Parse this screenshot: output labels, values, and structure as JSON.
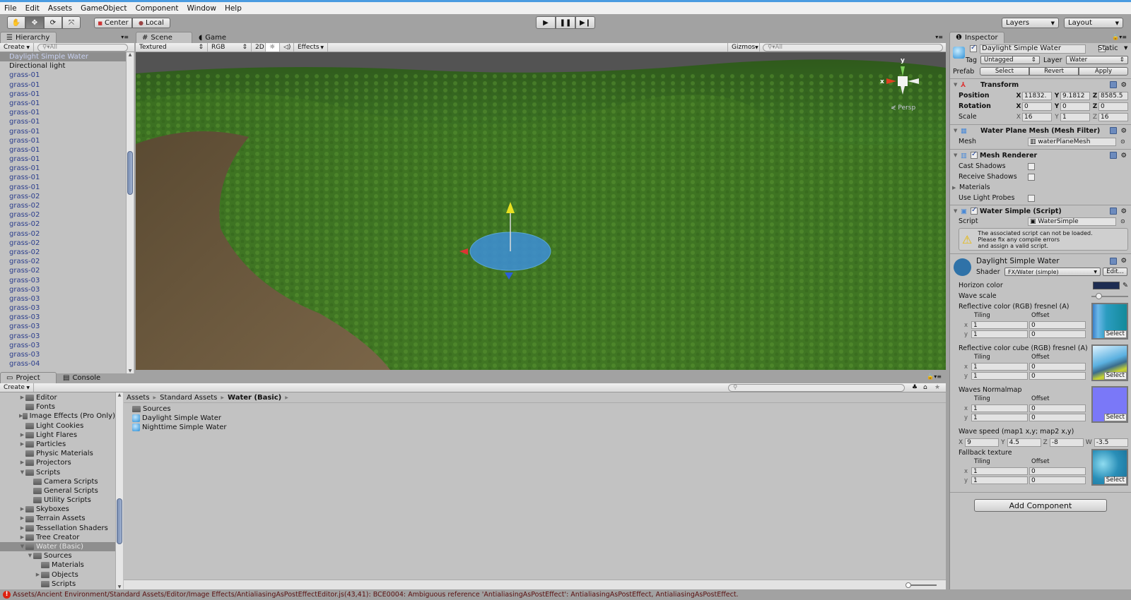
{
  "menu": [
    "File",
    "Edit",
    "Assets",
    "GameObject",
    "Component",
    "Window",
    "Help"
  ],
  "toolbar": {
    "tools": [
      "hand-icon",
      "move-icon",
      "rotate-icon",
      "scale-icon"
    ],
    "center": "Center",
    "local": "Local",
    "layers": "Layers",
    "layout": "Layout",
    "play": [
      "play-icon",
      "pause-icon",
      "step-icon"
    ]
  },
  "hierarchy": {
    "tab": "Hierarchy",
    "create": "Create",
    "search_placeholder": "All",
    "items": [
      "Daylight Simple Water",
      "Directional light",
      "grass-01",
      "grass-01",
      "grass-01",
      "grass-01",
      "grass-01",
      "grass-01",
      "grass-01",
      "grass-01",
      "grass-01",
      "grass-01",
      "grass-01",
      "grass-01",
      "grass-01",
      "grass-02",
      "grass-02",
      "grass-02",
      "grass-02",
      "grass-02",
      "grass-02",
      "grass-02",
      "grass-02",
      "grass-02",
      "grass-03",
      "grass-03",
      "grass-03",
      "grass-03",
      "grass-03",
      "grass-03",
      "grass-03",
      "grass-03",
      "grass-03",
      "grass-04"
    ],
    "selected": "Daylight Simple Water"
  },
  "scene": {
    "tab": "Scene",
    "game_tab": "Game",
    "shading": "Textured",
    "channel": "RGB",
    "mode_2d": "2D",
    "effects": "Effects",
    "gizmos": "Gizmos",
    "search_placeholder": "All",
    "persp": "Persp",
    "axis_x": "x",
    "axis_y": "y"
  },
  "project": {
    "tab": "Project",
    "console_tab": "Console",
    "create": "Create",
    "tree": [
      {
        "label": "Editor",
        "level": 0,
        "arrow": "closed"
      },
      {
        "label": "Fonts",
        "level": 0,
        "arrow": "none"
      },
      {
        "label": "Image Effects (Pro Only)",
        "level": 0,
        "arrow": "closed"
      },
      {
        "label": "Light Cookies",
        "level": 0,
        "arrow": "none"
      },
      {
        "label": "Light Flares",
        "level": 0,
        "arrow": "closed"
      },
      {
        "label": "Particles",
        "level": 0,
        "arrow": "closed"
      },
      {
        "label": "Physic Materials",
        "level": 0,
        "arrow": "none"
      },
      {
        "label": "Projectors",
        "level": 0,
        "arrow": "closed"
      },
      {
        "label": "Scripts",
        "level": 0,
        "arrow": "open"
      },
      {
        "label": "Camera Scripts",
        "level": 1,
        "arrow": "none"
      },
      {
        "label": "General Scripts",
        "level": 1,
        "arrow": "none"
      },
      {
        "label": "Utility Scripts",
        "level": 1,
        "arrow": "none"
      },
      {
        "label": "Skyboxes",
        "level": 0,
        "arrow": "closed"
      },
      {
        "label": "Terrain Assets",
        "level": 0,
        "arrow": "closed"
      },
      {
        "label": "Tessellation Shaders",
        "level": 0,
        "arrow": "closed"
      },
      {
        "label": "Tree Creator",
        "level": 0,
        "arrow": "closed"
      },
      {
        "label": "Water (Basic)",
        "level": 0,
        "arrow": "open",
        "selected": true
      },
      {
        "label": "Sources",
        "level": 1,
        "arrow": "open"
      },
      {
        "label": "Materials",
        "level": 2,
        "arrow": "none"
      },
      {
        "label": "Objects",
        "level": 2,
        "arrow": "closed"
      },
      {
        "label": "Scripts",
        "level": 2,
        "arrow": "none"
      }
    ],
    "breadcrumb": [
      "Assets",
      "Standard Assets",
      "Water (Basic)"
    ],
    "files": [
      {
        "label": "Sources",
        "icon": "folder-icon"
      },
      {
        "label": "Daylight Simple Water",
        "icon": "prefab-icon"
      },
      {
        "label": "Nighttime Simple Water",
        "icon": "prefab-icon"
      }
    ]
  },
  "inspector": {
    "tab": "Inspector",
    "name": "Daylight Simple Water",
    "static": "Static",
    "tag_label": "Tag",
    "tag": "Untagged",
    "layer_label": "Layer",
    "layer": "Water",
    "prefab_label": "Prefab",
    "prefab_buttons": [
      "Select",
      "Revert",
      "Apply"
    ],
    "transform": {
      "title": "Transform",
      "rows": [
        {
          "label": "Position",
          "x": "11832.",
          "y": "9.1812",
          "z": "8585.5"
        },
        {
          "label": "Rotation",
          "x": "0",
          "y": "0",
          "z": "0"
        },
        {
          "label": "Scale",
          "x": "16",
          "y": "1",
          "z": "16"
        }
      ]
    },
    "mesh_filter": {
      "title": "Water Plane Mesh (Mesh Filter)",
      "mesh_label": "Mesh",
      "mesh": "waterPlaneMesh"
    },
    "mesh_renderer": {
      "title": "Mesh Renderer",
      "cast": "Cast Shadows",
      "receive": "Receive Shadows",
      "materials": "Materials",
      "probes": "Use Light Probes"
    },
    "script": {
      "title": "Water Simple (Script)",
      "script_label": "Script",
      "script": "WaterSimple",
      "warning": "The associated script can not be loaded.\nPlease fix any compile errors\nand assign a valid script."
    },
    "material": {
      "name": "Daylight Simple Water",
      "shader_label": "Shader",
      "shader": "FX/Water (simple)",
      "edit": "Edit...",
      "horizon_label": "Horizon color",
      "horizon_color": "#1e2d52",
      "wave_scale_label": "Wave scale",
      "wave_scale": 0.15,
      "tiling": "Tiling",
      "offset": "Offset",
      "select": "Select",
      "textures": [
        {
          "label": "Reflective color (RGB) fresnel (A)",
          "tx": "1",
          "ty": "1",
          "ox": "0",
          "oy": "0",
          "thumb": "linear-gradient(90deg,#3a7fc8,#6cb8e8 15%,#2b9cc0 40%,#138a9a)"
        },
        {
          "label": "Reflective color cube (RGB) fresnel (A)",
          "tx": "1",
          "ty": "1",
          "ox": "0",
          "oy": "0",
          "thumb": "linear-gradient(160deg,#dff3ff,#5ab0e0 45%,#3b6c8c 60%,#c8d430 75%,#777)"
        },
        {
          "label": "Waves Normalmap",
          "tx": "1",
          "ty": "1",
          "ox": "0",
          "oy": "0",
          "thumb": "#7a78f8"
        }
      ],
      "wave_speed_label": "Wave speed (map1 x,y; map2 x,y)",
      "wave_speed": {
        "X": "9",
        "Y": "4.5",
        "Z": "-8",
        "W": "-3.5"
      },
      "fallback": {
        "label": "Fallback texture",
        "tx": "1",
        "ty": "1",
        "ox": "0",
        "oy": "0",
        "thumb": "radial-gradient(circle at 30% 40%,#8fdcf0,#2a8fb8 50%,#1a6f96)"
      }
    },
    "add_component": "Add Component"
  },
  "status": {
    "error": "Assets/Ancient Environment/Standard Assets/Editor/Image Effects/AntialiasingAsPostEffectEditor.js(43,41): BCE0004: Ambiguous reference 'AntialiasingAsPostEffect': AntialiasingAsPostEffect, AntialiasingAsPostEffect."
  }
}
